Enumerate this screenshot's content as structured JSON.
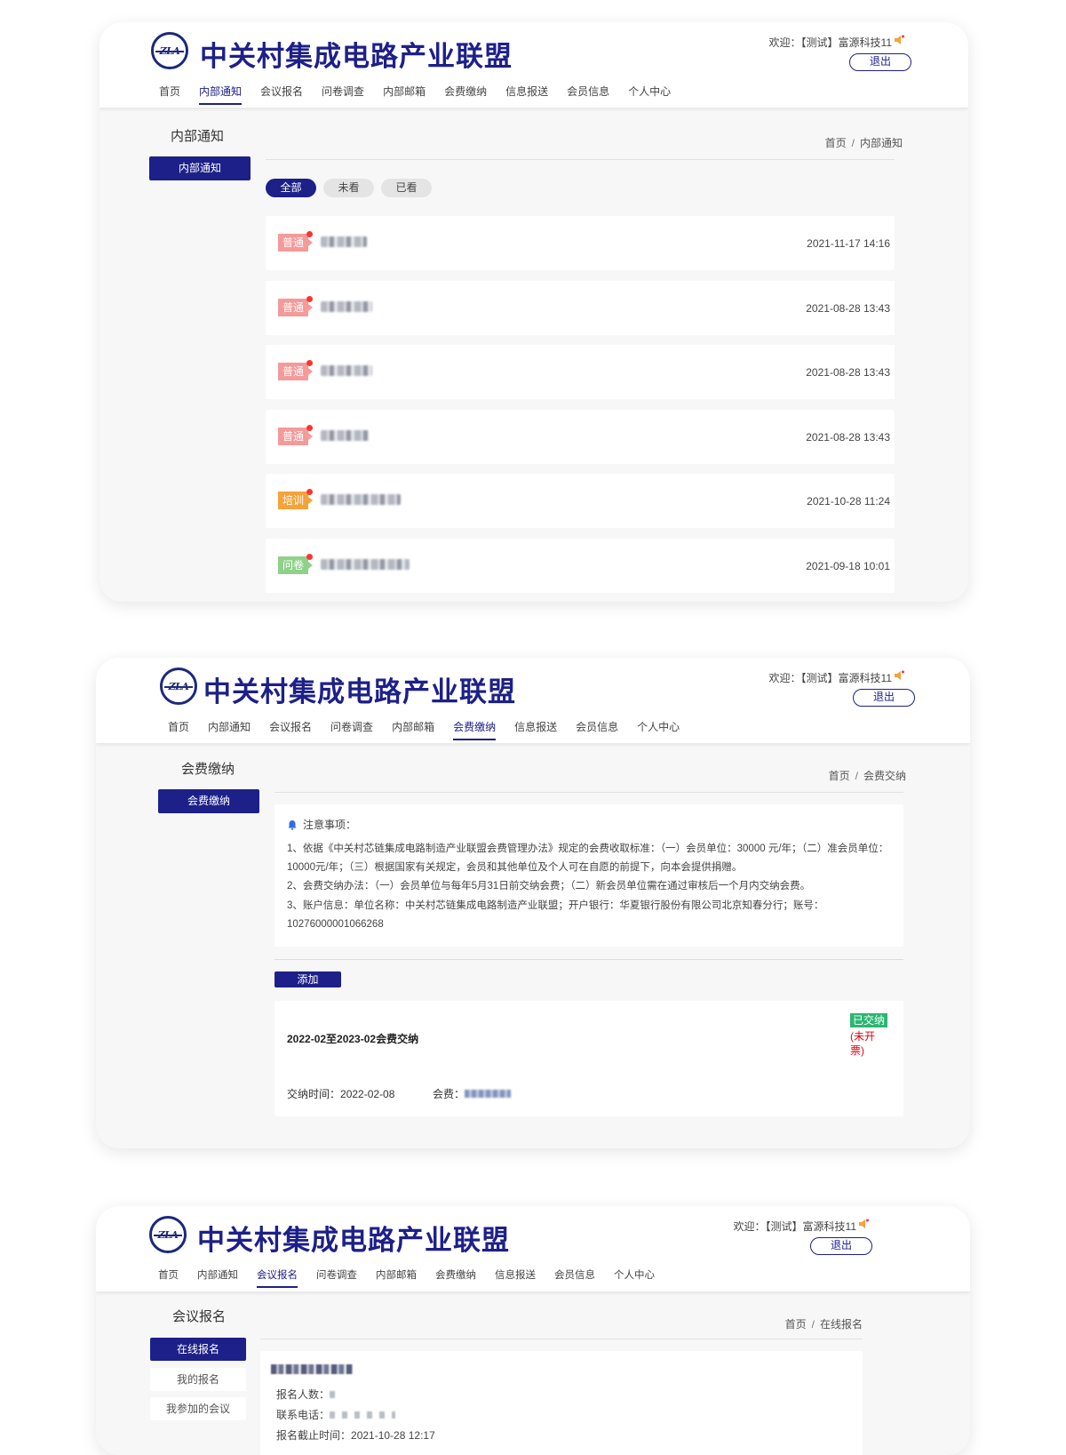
{
  "site": {
    "logo_text": "ZLA",
    "title": "中关村集成电路产业联盟",
    "welcome": "欢迎：【测试】富源科技11",
    "logout": "退出",
    "brand_color": "#1d2088"
  },
  "screens": [
    {
      "nav": [
        "首页",
        "内部通知",
        "会议报名",
        "问卷调查",
        "内部邮箱",
        "会费缴纳",
        "信息报送",
        "会员信息",
        "个人中心"
      ],
      "active_nav": "内部通知",
      "side_title": "内部通知",
      "side_buttons": [
        "内部通知"
      ],
      "breadcrumb": [
        "首页",
        "内部通知"
      ],
      "filters": [
        "全部",
        "未看",
        "已看"
      ],
      "notices": [
        {
          "tag": "普通",
          "tag_color": "#f59a9a",
          "time": "2021-11-17 14:16"
        },
        {
          "tag": "普通",
          "tag_color": "#f59a9a",
          "time": "2021-08-28 13:43"
        },
        {
          "tag": "普通",
          "tag_color": "#f59a9a",
          "time": "2021-08-28 13:43"
        },
        {
          "tag": "普通",
          "tag_color": "#f59a9a",
          "time": "2021-08-28 13:43"
        },
        {
          "tag": "培训",
          "tag_color": "#f5a339",
          "time": "2021-10-28 11:24"
        },
        {
          "tag": "问卷",
          "tag_color": "#8fd18b",
          "time": "2021-09-18 10:01"
        }
      ]
    },
    {
      "nav": [
        "首页",
        "内部通知",
        "会议报名",
        "问卷调查",
        "内部邮箱",
        "会费缴纳",
        "信息报送",
        "会员信息",
        "个人中心"
      ],
      "active_nav": "会费缴纳",
      "side_title": "会费缴纳",
      "side_buttons": [
        "会费缴纳"
      ],
      "breadcrumb": [
        "首页",
        "会费交纳"
      ],
      "note_head": "注意事项：",
      "note_lines": [
        "1、依据《中关村芯链集成电路制造产业联盟会费管理办法》规定的会费收取标准：（一）会员单位：30000 元/年；（二）准会员单位：10000元/年；（三）根据国家有关规定，会员和其他单位及个人可在自愿的前提下，向本会提供捐赠。",
        "2、会费交纳办法：（一）会员单位与每年5月31日前交纳会费；（二）新会员单位需在通过审核后一个月内交纳会费。",
        "3、账户信息：单位名称：中关村芯链集成电路制造产业联盟；开户银行：华夏银行股份有限公司北京知春分行；账号：10276000001066268"
      ],
      "add_button": "添加",
      "fee": {
        "title": "2022-02至2023-02会费交纳",
        "status": "已交纳",
        "invoice": "(未开票)",
        "pay_time_label": "交纳时间：",
        "pay_time": "2022-02-08",
        "amount_label": "会费："
      }
    },
    {
      "nav": [
        "首页",
        "内部通知",
        "会议报名",
        "问卷调查",
        "内部邮箱",
        "会费缴纳",
        "信息报送",
        "会员信息",
        "个人中心"
      ],
      "active_nav": "会议报名",
      "side_title": "会议报名",
      "side_buttons": [
        "在线报名",
        "我的报名",
        "我参加的会议"
      ],
      "breadcrumb": [
        "首页",
        "在线报名"
      ],
      "meeting": {
        "count_label": "报名人数：",
        "phone_label": "联系电话：",
        "deadline_label": "报名截止时间：",
        "deadline": "2021-10-28 12:17"
      }
    }
  ]
}
